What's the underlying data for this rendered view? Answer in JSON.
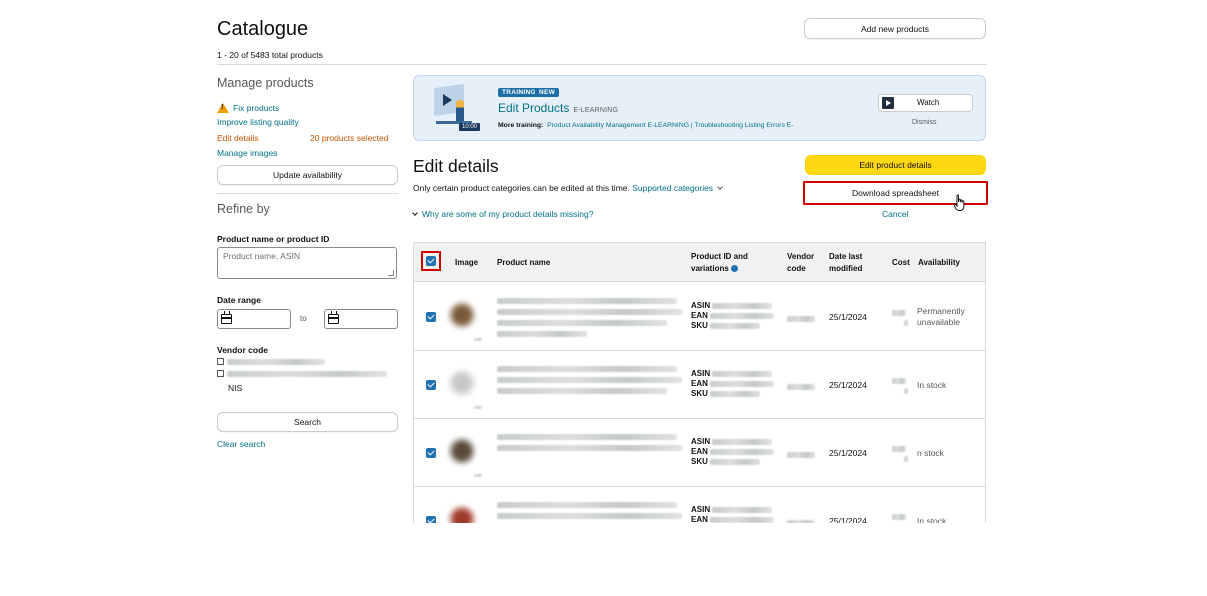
{
  "header": {
    "title": "Catalogue",
    "subtitle": "1 - 20 of 5483 total products",
    "add_button": "Add new products"
  },
  "manage": {
    "title": "Manage products",
    "fix": "Fix products",
    "improve": "Improve listing quality",
    "edit": "Edit details",
    "selected": "20 products selected",
    "images": "Manage images",
    "update_button": "Update availability"
  },
  "refine": {
    "title": "Refine by",
    "product_label": "Product name or product ID",
    "product_placeholder": "Product name, ASIN",
    "date_label": "Date range",
    "date_to": "to",
    "vendor_label": "Vendor code",
    "vendor_extra": "NIS",
    "search_button": "Search",
    "clear": "Clear search"
  },
  "banner": {
    "tag_training": "TRAINING",
    "tag_new": "NEW",
    "title": "Edit Products",
    "subtag": "E-LEARNING",
    "duration": "10:00",
    "more_label": "More training:",
    "more_links": "Product Availability Management E-LEARNING  |  Troubleshooting Listing Errors E-",
    "watch": "Watch",
    "dismiss": "Dismiss"
  },
  "edit": {
    "title": "Edit details",
    "subtitle": "Only certain product categories can be edited at this time.",
    "supported": "Supported categories",
    "why": "Why are some of my product details missing?",
    "edit_button": "Edit product details",
    "download_button": "Download spreadsheet",
    "cancel": "Cancel"
  },
  "table": {
    "headers": {
      "image": "Image",
      "name": "Product name",
      "id_1": "Product ID and",
      "id_2": "variations",
      "vendor_1": "Vendor",
      "vendor_2": "code",
      "date_1": "Date last",
      "date_2": "modified",
      "cost": "Cost",
      "availability": "Availability"
    },
    "id_labels": {
      "asin": "ASIN",
      "ean": "EAN",
      "sku": "SKU"
    },
    "rows": [
      {
        "date": "25/1/2024",
        "availability_1": "Permanently",
        "availability_2": "unavailable",
        "color": "#7a5a3a"
      },
      {
        "date": "25/1/2024",
        "availability_1": "In stock",
        "availability_2": "",
        "color": "#c8c8c8"
      },
      {
        "date": "25/1/2024",
        "availability_1": "n stock",
        "availability_2": "",
        "color": "#5a4a3a"
      },
      {
        "date": "25/1/2024",
        "availability_1": "In stock",
        "availability_2": "",
        "color": "#a03a2a"
      }
    ]
  }
}
